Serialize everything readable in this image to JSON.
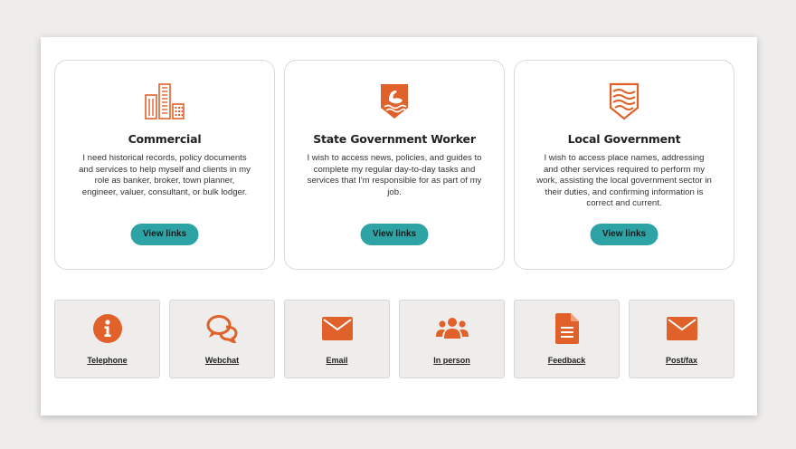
{
  "theme": {
    "accent": "#e0622a",
    "teal": "#2ea3a6"
  },
  "cards": [
    {
      "icon": "buildings-icon",
      "title": "Commercial",
      "description": "I need historical records, policy documents and services to help myself and clients in my role as banker, broker, town planner, engineer, valuer, consultant, or bulk lodger.",
      "button": "View links"
    },
    {
      "icon": "swan-shield-icon",
      "title": "State Government Worker",
      "description": "I wish to access news, policies, and guides to complete my regular day-to-day tasks and services that I'm responsible for as part of my job.",
      "button": "View links"
    },
    {
      "icon": "wave-shield-icon",
      "title": "Local Government",
      "description": "I wish to access place names, addressing and other services required to perform my work, assisting the local government sector in their duties, and confirming information is correct and current.",
      "button": "View links"
    }
  ],
  "contacts": [
    {
      "icon": "info-icon",
      "label": "Telephone"
    },
    {
      "icon": "chat-icon",
      "label": "Webchat"
    },
    {
      "icon": "envelope-icon",
      "label": "Email"
    },
    {
      "icon": "people-icon",
      "label": "In person"
    },
    {
      "icon": "document-icon",
      "label": "Feedback"
    },
    {
      "icon": "envelope-icon",
      "label": "Post/fax"
    }
  ]
}
